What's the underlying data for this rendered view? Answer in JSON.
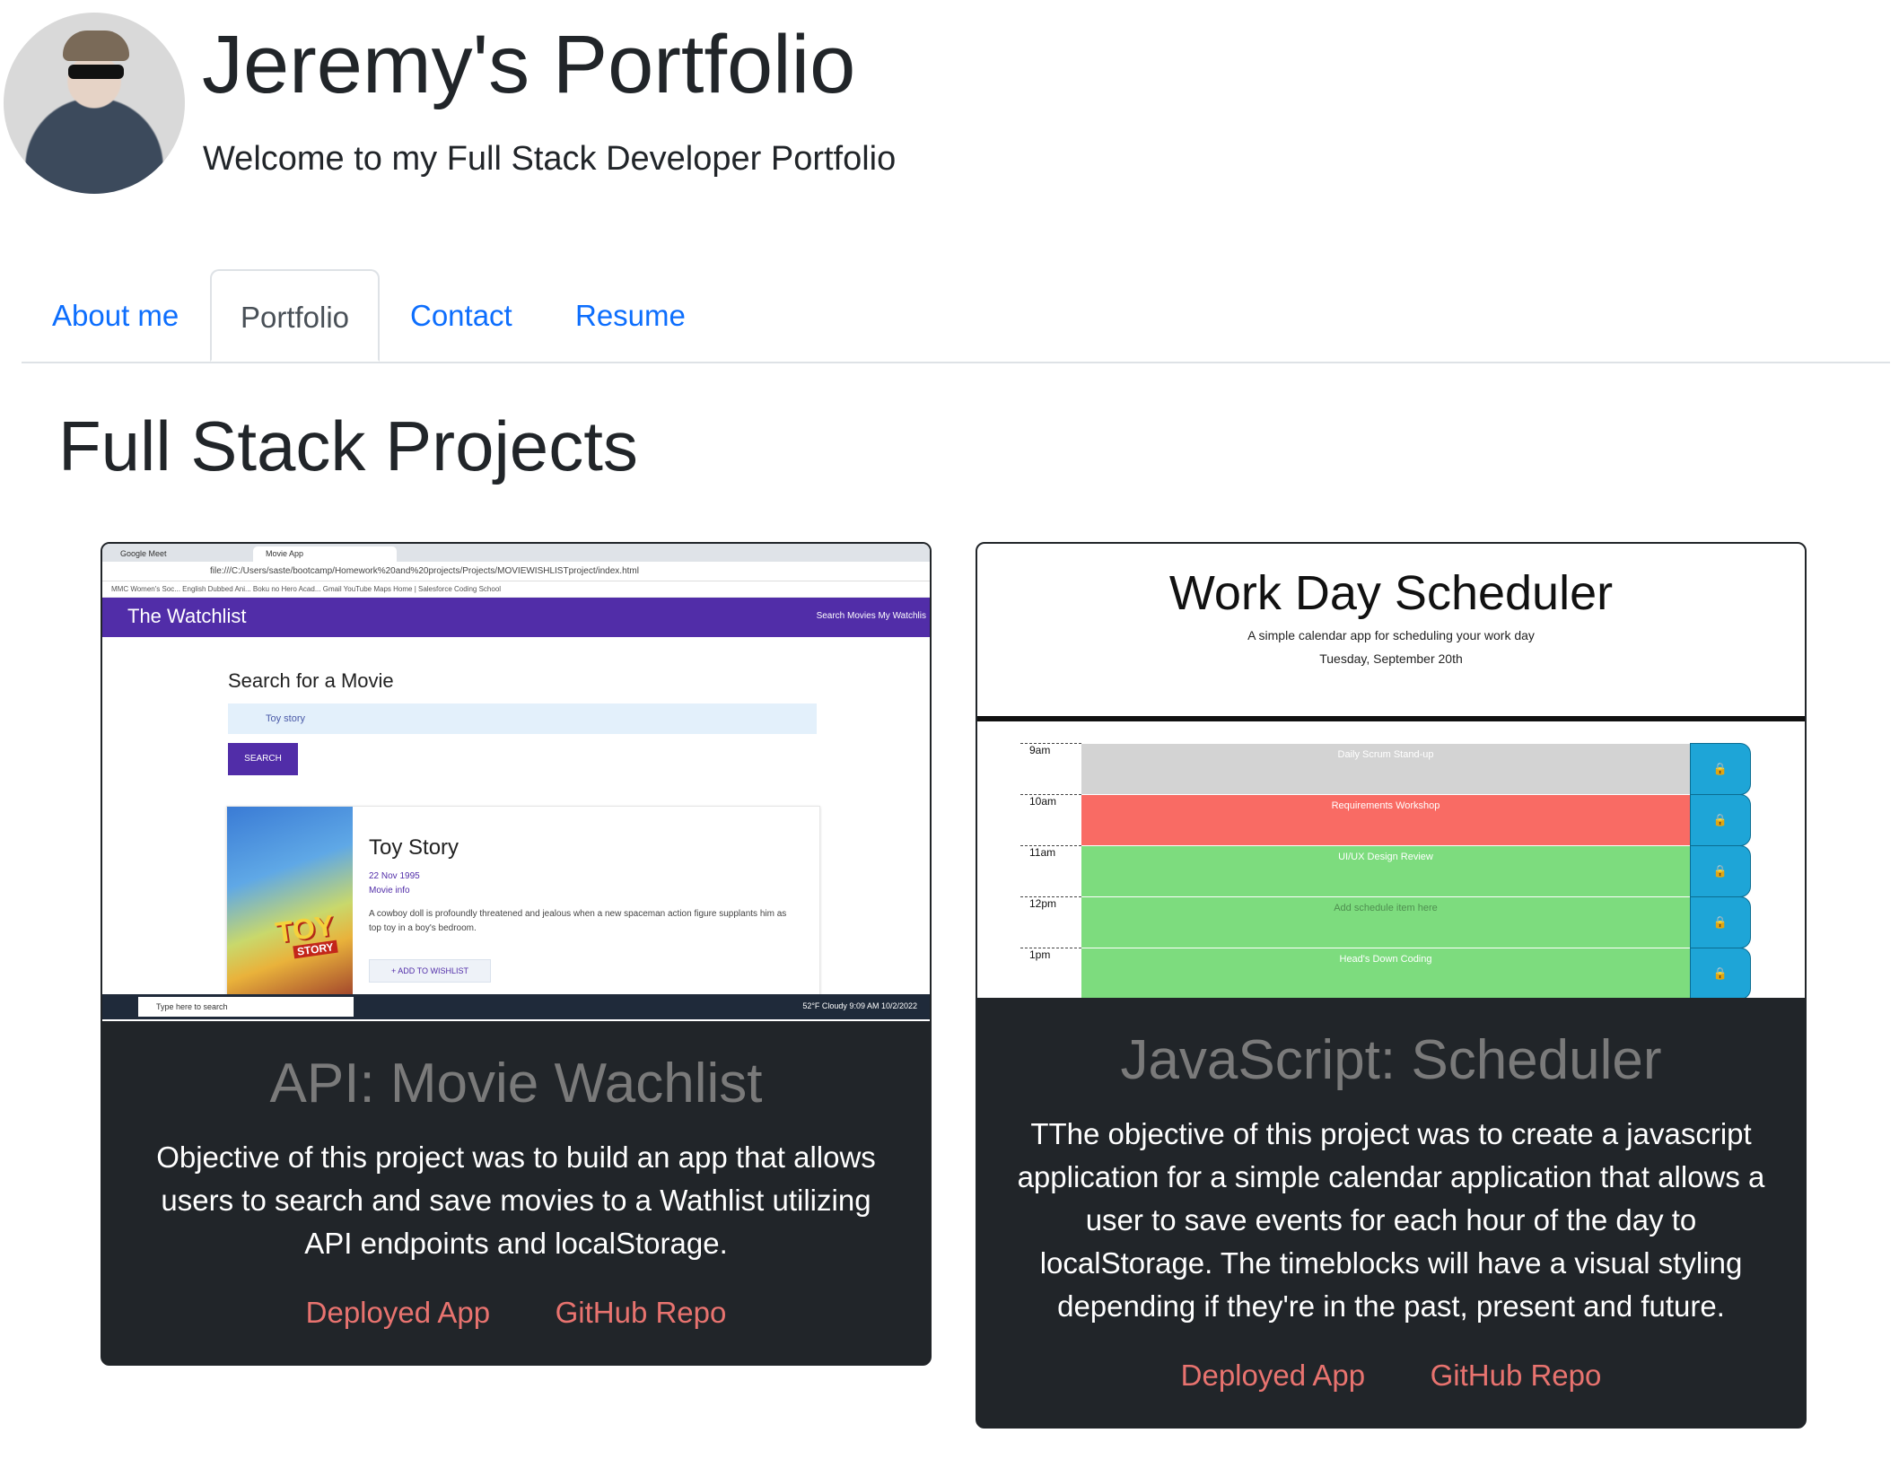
{
  "header": {
    "title": "Jeremy's Portfolio",
    "subtitle": "Welcome to my Full Stack Developer Portfolio"
  },
  "nav": {
    "tabs": [
      {
        "label": "About me",
        "active": false
      },
      {
        "label": "Portfolio",
        "active": true
      },
      {
        "label": "Contact",
        "active": false
      },
      {
        "label": "Resume",
        "active": false
      }
    ]
  },
  "section": {
    "title": "Full Stack Projects"
  },
  "projects": [
    {
      "title": "API: Movie Wachlist",
      "description": "Objective of this project was to build an app that allows users to search and save movies to a Wathlist utilizing API endpoints and localStorage.",
      "links": {
        "deployed": "Deployed App",
        "repo": "GitHub Repo"
      },
      "screenshot": {
        "browser_tabs": [
          "Google Meet",
          "Movie App"
        ],
        "url": "file:///C:/Users/saste/bootcamp/Homework%20and%20projects/Projects/MOVIEWISHLISTproject/index.html",
        "bookmarks": "MMC Women's Soc...   English Dubbed Ani...   Boku no Hero Acad...   Gmail   YouTube   Maps   Home | Salesforce   Coding School",
        "brand": "The Watchlist",
        "nav_links": "Search Movies    My Watchlis",
        "search_heading": "Search for a Movie",
        "search_value": "Toy story",
        "search_button": "SEARCH",
        "movie_title": "Toy Story",
        "release_date": "22 Nov 1995",
        "movie_info": "Movie info",
        "movie_desc": "A cowboy doll is profoundly threatened and jealous when a new spaceman action figure supplants him as top toy in a boy's bedroom.",
        "add_button": "+   ADD TO WISHLIST",
        "poster_title": "TOY",
        "poster_sub": "STORY",
        "taskbar_search": "Type here to search",
        "taskbar_status": "52°F Cloudy   9:09 AM  10/2/2022"
      }
    },
    {
      "title": "JavaScript: Scheduler",
      "description": "TThe objective of this project was to create a javascript application for a simple calendar application that allows a user to save events for each hour of the day to localStorage. The timeblocks will have a visual styling depending if they're in the past, present and future.",
      "links": {
        "deployed": "Deployed App",
        "repo": "GitHub Repo"
      },
      "screenshot": {
        "title": "Work Day Scheduler",
        "subtitle": "A simple calendar app for scheduling your work day",
        "date": "Tuesday, September 20th",
        "rows": [
          {
            "hour": "9am",
            "text": "Daily Scrum Stand-up",
            "state": "past"
          },
          {
            "hour": "10am",
            "text": "Requirements Workshop",
            "state": "present"
          },
          {
            "hour": "11am",
            "text": "UI/UX Design Review",
            "state": "future"
          },
          {
            "hour": "12pm",
            "text": "Add schedule item here",
            "state": "future"
          },
          {
            "hour": "1pm",
            "text": "Head's Down Coding",
            "state": "future"
          }
        ]
      }
    }
  ],
  "colors": {
    "tab_link": "#0d6efd",
    "card_bg": "#212529",
    "card_link": "#e8736f",
    "card_title": "#7a7a7a",
    "watchlist_purple": "#512da8",
    "past": "#d3d3d3",
    "present": "#f96b64",
    "future": "#7ddc7e",
    "save_btn": "#1ea5d7"
  },
  "icons": {
    "lock": "lock-icon",
    "plus": "plus-icon"
  }
}
